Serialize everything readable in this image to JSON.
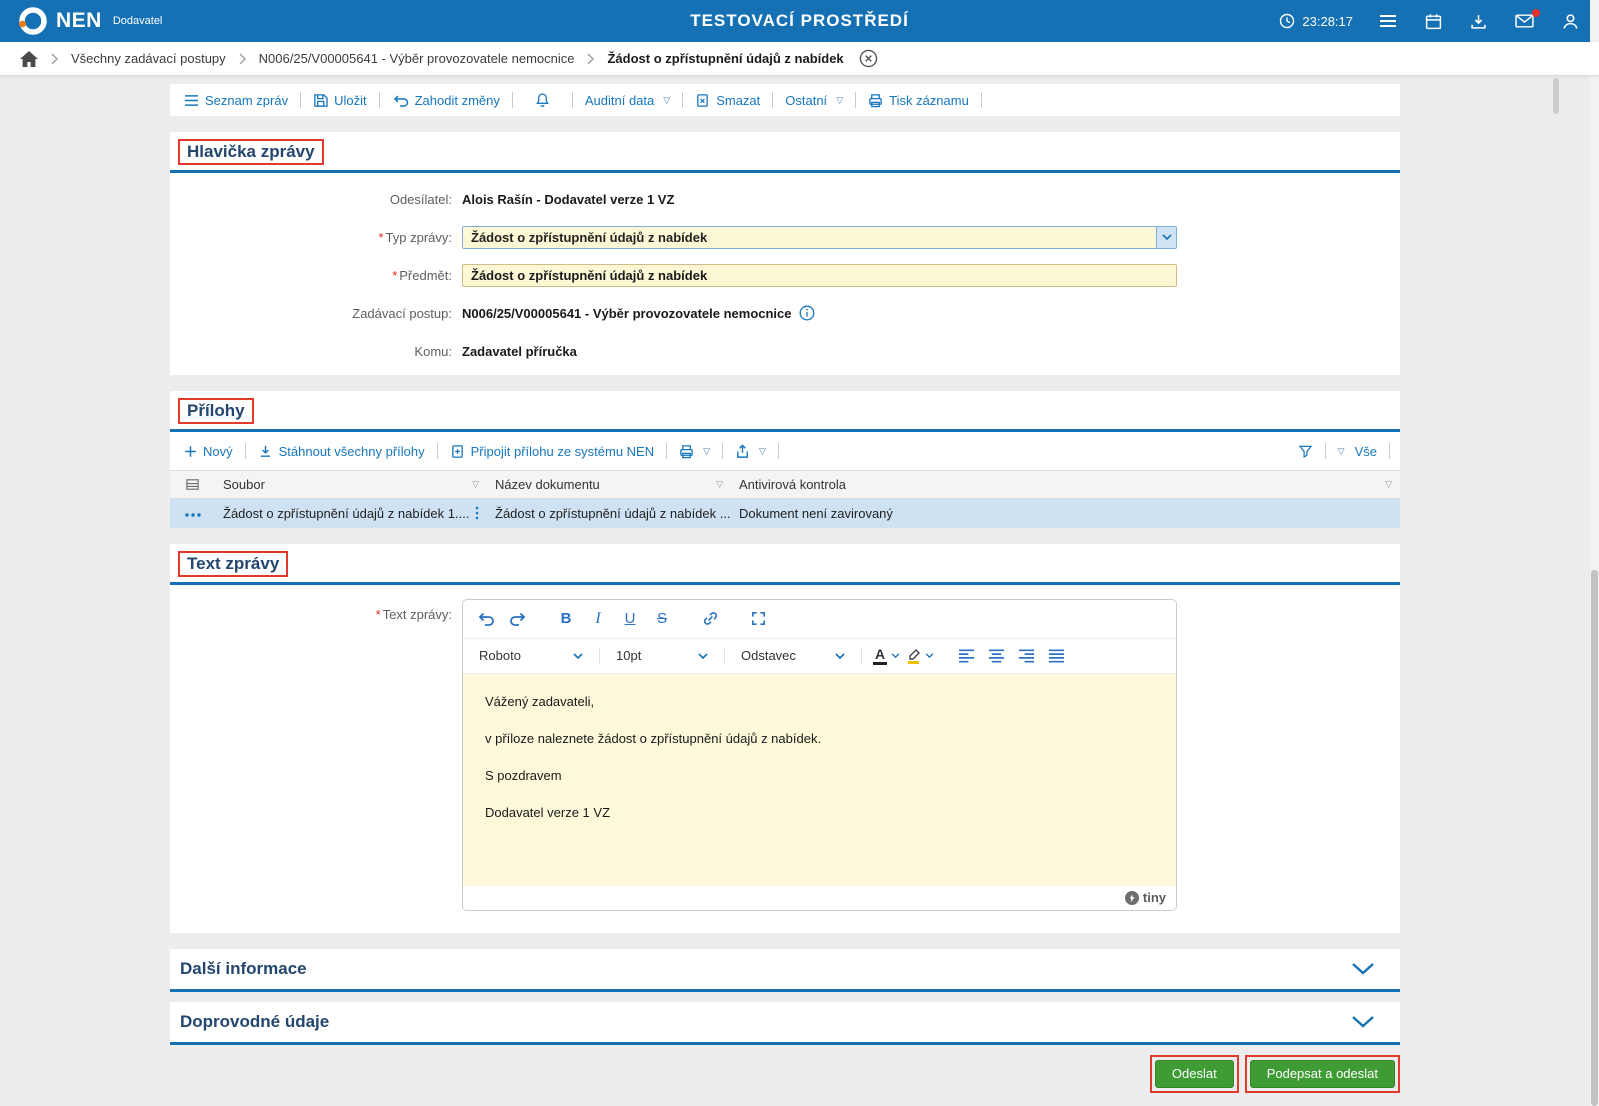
{
  "header": {
    "brand": "NEN",
    "brand_sub": "Dodavatel",
    "env_title": "TESTOVACÍ PROSTŘEDÍ",
    "time": "23:28:17"
  },
  "breadcrumb": {
    "items": [
      "Všechny zadávací postupy",
      "N006/25/V00005641 - Výběr provozovatele nemocnice",
      "Žádost o zpřístupnění údajů z nabídek"
    ]
  },
  "toolbar": {
    "seznam_zprav": "Seznam zpráv",
    "ulozit": "Uložit",
    "zahodit_zmeny": "Zahodit změny",
    "auditni_data": "Auditní data",
    "smazat": "Smazat",
    "ostatni": "Ostatní",
    "tisk_zaznamu": "Tisk záznamu"
  },
  "hlavicka": {
    "title": "Hlavička zprávy",
    "required_marker": "*",
    "fields": {
      "odesilatel": {
        "label": "Odesílatel:",
        "value": "Alois Rašín - Dodavatel verze 1 VZ"
      },
      "typ_zpravy": {
        "label": "Typ zprávy:",
        "value": "Žádost o zpřístupnění údajů z nabídek"
      },
      "predmet": {
        "label": "Předmět:",
        "value": "Žádost o zpřístupnění údajů z nabídek"
      },
      "zadavaci_postup": {
        "label": "Zadávací postup:",
        "value": "N006/25/V00005641 - Výběr provozovatele nemocnice"
      },
      "komu": {
        "label": "Komu:",
        "value": "Zadavatel příručka"
      }
    }
  },
  "prilohy": {
    "title": "Přílohy",
    "toolbar": {
      "novy": "Nový",
      "stahnout": "Stáhnout všechny přílohy",
      "pripojit": "Připojit přílohu ze systému NEN",
      "vse": "Vše"
    },
    "table": {
      "columns": [
        "Soubor",
        "Název dokumentu",
        "Antivirová kontrola"
      ],
      "rows": [
        {
          "soubor": "Žádost o zpřístupnění údajů z nabídek 1....",
          "nazev": "Žádost o zpřístupnění údajů z nabídek ...",
          "antivir": "Dokument není zavirovaný"
        }
      ]
    }
  },
  "text_zpravy": {
    "title": "Text zprávy",
    "label": "Text zprávy:",
    "editor": {
      "font_family": "Roboto",
      "font_size": "10pt",
      "block_format": "Odstavec",
      "paragraphs": [
        "Vážený zadavateli,",
        "v příloze naleznete žádost o zpřístupnění údajů z nabídek.",
        "S pozdravem",
        "Dodavatel verze 1 VZ"
      ],
      "brand": "tiny"
    }
  },
  "collapsed_sections": {
    "dalsi_informace": "Další informace",
    "doprovodne_udaje": "Doprovodné údaje"
  },
  "actions": {
    "odeslat": "Odeslat",
    "podepsat_a_odeslat": "Podepsat a odeslat"
  },
  "icons": {
    "caret_outline": "▽",
    "bold": "B",
    "italic": "I",
    "underline": "U",
    "strikethrough": "S",
    "text_color": "A"
  },
  "colors": {
    "header_blue": "#1571b3",
    "link_blue": "#1777bd",
    "section_navy": "#24466e",
    "field_yellow": "#fcf7d4",
    "selected_row": "#cfe2f3",
    "button_green": "#3f9c35",
    "annotation_red": "#e23b2e"
  }
}
